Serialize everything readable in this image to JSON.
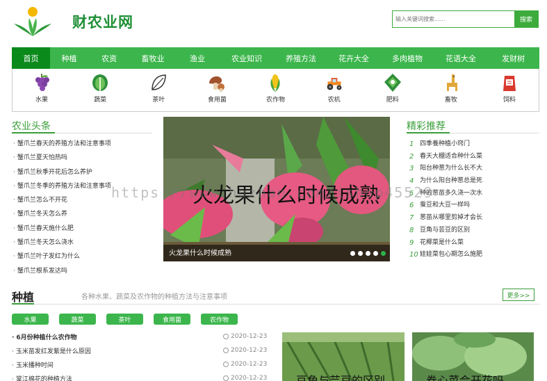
{
  "header": {
    "site_name": "财农业网",
    "search_placeholder": "输入关键词搜索......",
    "search_button": "搜索"
  },
  "nav": [
    {
      "label": "首页",
      "active": true
    },
    {
      "label": "种植"
    },
    {
      "label": "农资"
    },
    {
      "label": "畜牧业"
    },
    {
      "label": "渔业"
    },
    {
      "label": "农业知识"
    },
    {
      "label": "养殖方法"
    },
    {
      "label": "花卉大全"
    },
    {
      "label": "多肉植物"
    },
    {
      "label": "花语大全"
    },
    {
      "label": "发财树"
    }
  ],
  "categories": [
    {
      "label": "水果",
      "icon": "grape-icon"
    },
    {
      "label": "蔬菜",
      "icon": "cabbage-icon"
    },
    {
      "label": "茶叶",
      "icon": "tea-leaf-icon"
    },
    {
      "label": "食用菌",
      "icon": "mushroom-icon"
    },
    {
      "label": "农作物",
      "icon": "corn-icon"
    },
    {
      "label": "农机",
      "icon": "tractor-icon"
    },
    {
      "label": "肥料",
      "icon": "fertilizer-icon"
    },
    {
      "label": "畜牧",
      "icon": "alpaca-icon"
    },
    {
      "label": "饲料",
      "icon": "feed-bag-icon"
    }
  ],
  "headlines": {
    "title": "农业头条",
    "items": [
      "蟹爪兰春天的养殖方法和注意事项",
      "蟹爪兰夏天怕热吗",
      "蟹爪兰秋季开花后怎么养护",
      "蟹爪兰冬季的养殖方法和注意事项",
      "蟹爪兰怎么不开花",
      "蟹爪兰冬天怎么养",
      "蟹爪兰春天施什么肥",
      "蟹爪兰冬天怎么浇水",
      "蟹爪兰叶子发红为什么",
      "蟹爪兰根系发达吗"
    ]
  },
  "banner": {
    "caption": "火龙果什么时候成熟",
    "overlay_text": "火龙果什么时候成熟",
    "slide_count": 5,
    "active_slide": 5
  },
  "recommend": {
    "title": "精彩推荐",
    "items": [
      {
        "num": "1",
        "text": "四季養种植小窍门"
      },
      {
        "num": "2",
        "text": "春天大棚适合种什么菜"
      },
      {
        "num": "3",
        "text": "阳台种葱为什么长不大"
      },
      {
        "num": "4",
        "text": "为什么阳台种葱总是死"
      },
      {
        "num": "5",
        "text": "种的葱苗多久浇一次水"
      },
      {
        "num": "6",
        "text": "蚕豆和大豆一样吗"
      },
      {
        "num": "7",
        "text": "葱苗从哪里剪掉才会长"
      },
      {
        "num": "8",
        "text": "豆角与芸豆的区别"
      },
      {
        "num": "9",
        "text": "花椰菜是什么菜"
      },
      {
        "num": "10",
        "text": "娃娃菜包心期怎么施肥"
      }
    ]
  },
  "watermark": "https://www.huzhan.com/ishop45529",
  "planting": {
    "title": "种植",
    "description": "各种水果、蔬菜及农作物的种植方法与注意事项",
    "more": "更多>>",
    "tags": [
      "水果",
      "蔬菜",
      "茶叶",
      "食用菌",
      "农作物"
    ],
    "articles": [
      {
        "title": "6月份种植什么农作物",
        "date": "2020-12-23"
      },
      {
        "title": "玉米苗发红发紫是什么原因",
        "date": "2020-12-23"
      },
      {
        "title": "玉米播种时间",
        "date": "2020-12-23"
      },
      {
        "title": "棠江棉花的种植方法",
        "date": "2020-12-23"
      }
    ],
    "thumbs": [
      {
        "caption": "豆角与芸豆的区别"
      },
      {
        "caption": "卷心菜会开花吗"
      }
    ]
  },
  "colors": {
    "brand_green": "#3cb64c",
    "nav_active": "#0b8a1c",
    "title_green": "#3a9e3a"
  }
}
